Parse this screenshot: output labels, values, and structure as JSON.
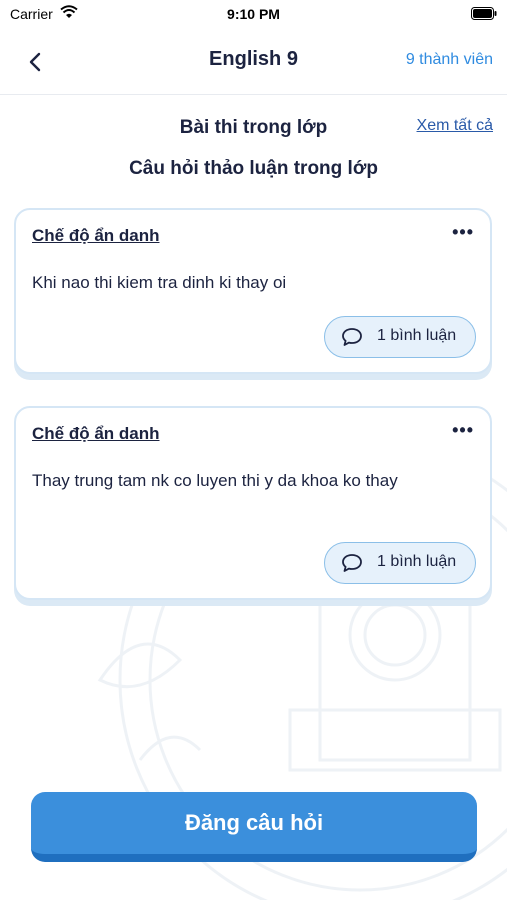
{
  "status_bar": {
    "carrier": "Carrier",
    "time": "9:10 PM"
  },
  "header": {
    "title": "English 9",
    "members": "9 thành viên"
  },
  "section": {
    "exams_title": "Bài thi trong lớp",
    "see_all": "Xem tất cả",
    "discussion_title": "Câu hỏi thảo luận trong lớp"
  },
  "posts": [
    {
      "author": "Chế độ ẩn danh",
      "text": "Khi nao thi kiem tra dinh ki thay oi",
      "comments": "1 bình luận"
    },
    {
      "author": "Chế độ ẩn danh",
      "text": "Thay trung tam nk co luyen thi y da khoa ko thay",
      "comments": "1 bình luận"
    }
  ],
  "actions": {
    "post_question": "Đăng câu hỏi"
  },
  "colors": {
    "accent": "#3b8fdc",
    "link": "#2f8be0",
    "text": "#1c2340"
  },
  "icons": {
    "back": "chevron-left-icon",
    "more": "more-horizontal-icon",
    "comment": "speech-bubble-icon"
  }
}
